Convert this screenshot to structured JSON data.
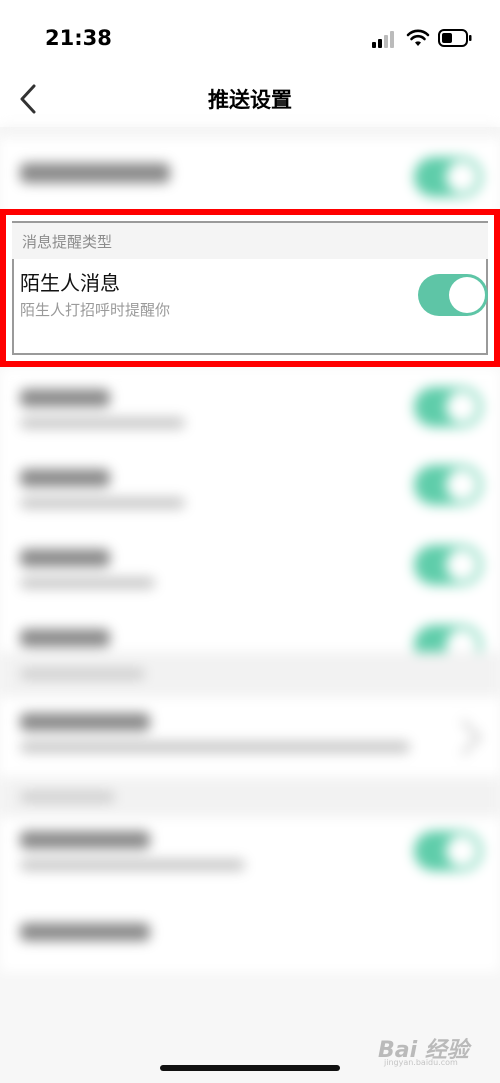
{
  "status_bar": {
    "time": "21:38",
    "icons": [
      "cellular-signal-icon",
      "wifi-icon",
      "battery-icon"
    ]
  },
  "nav": {
    "back_icon": "chevron-left-icon",
    "title": "推送设置"
  },
  "highlighted_group": {
    "section_header": "消息提醒类型",
    "setting": {
      "title": "陌生人消息",
      "description": "陌生人打招呼时提醒你",
      "enabled": true
    }
  },
  "colors": {
    "accent_toggle": "#5ec5a6",
    "highlight_border": "#ff0000",
    "background": "#f7f7f7"
  },
  "watermark": {
    "text": "Bai 经验",
    "sub": "jingyan.baidu.com"
  }
}
